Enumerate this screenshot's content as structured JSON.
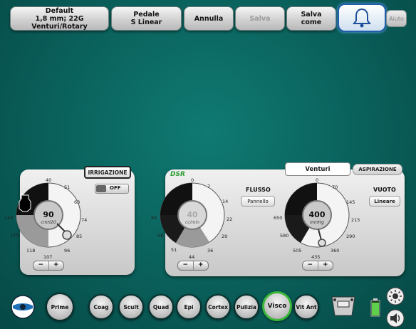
{
  "topbar": {
    "settings_line1": "Default",
    "settings_line2": "1,8 mm; 22G Venturi/Rotary",
    "pedal_line1": "Pedale",
    "pedal_line2": "S Linear",
    "cancel": "Annulla",
    "save": "Salva",
    "saveas_line1": "Salva",
    "saveas_line2": "come",
    "help": "Aiuto"
  },
  "irrigation": {
    "title": "IRRIGAZIONE",
    "toggle": "OFF",
    "value": "90",
    "unit": "cmH20",
    "scale": [
      "40",
      "51",
      "63",
      "74",
      "85",
      "96",
      "107",
      "118",
      "129",
      "140"
    ]
  },
  "flow": {
    "logo": "DSR",
    "label": "FLUSSO",
    "mode_button": "Pannello",
    "value": "40",
    "unit": "cc/min",
    "scale": [
      "0",
      "7",
      "14",
      "22",
      "29",
      "36",
      "44",
      "51",
      "58",
      "65"
    ]
  },
  "vacuum": {
    "tab_active": "Venturi",
    "tab_inactive": "ASPIRAZIONE",
    "label": "VUOTO",
    "mode_button": "Lineare",
    "value": "400",
    "unit": "mmHg",
    "scale": [
      "0",
      "70",
      "145",
      "215",
      "290",
      "360",
      "435",
      "505",
      "580",
      "650"
    ]
  },
  "modes": [
    {
      "label": "Prime"
    },
    {
      "label": "Coag"
    },
    {
      "label": "Scult"
    },
    {
      "label": "Quad"
    },
    {
      "label": "Epi"
    },
    {
      "label": "Cortex"
    },
    {
      "label": "Pulizia"
    },
    {
      "label": "Visco"
    },
    {
      "label": "Vit Ant"
    }
  ],
  "colors": {
    "accent_selected": "#39b83a",
    "background": "#0a5f5a"
  }
}
